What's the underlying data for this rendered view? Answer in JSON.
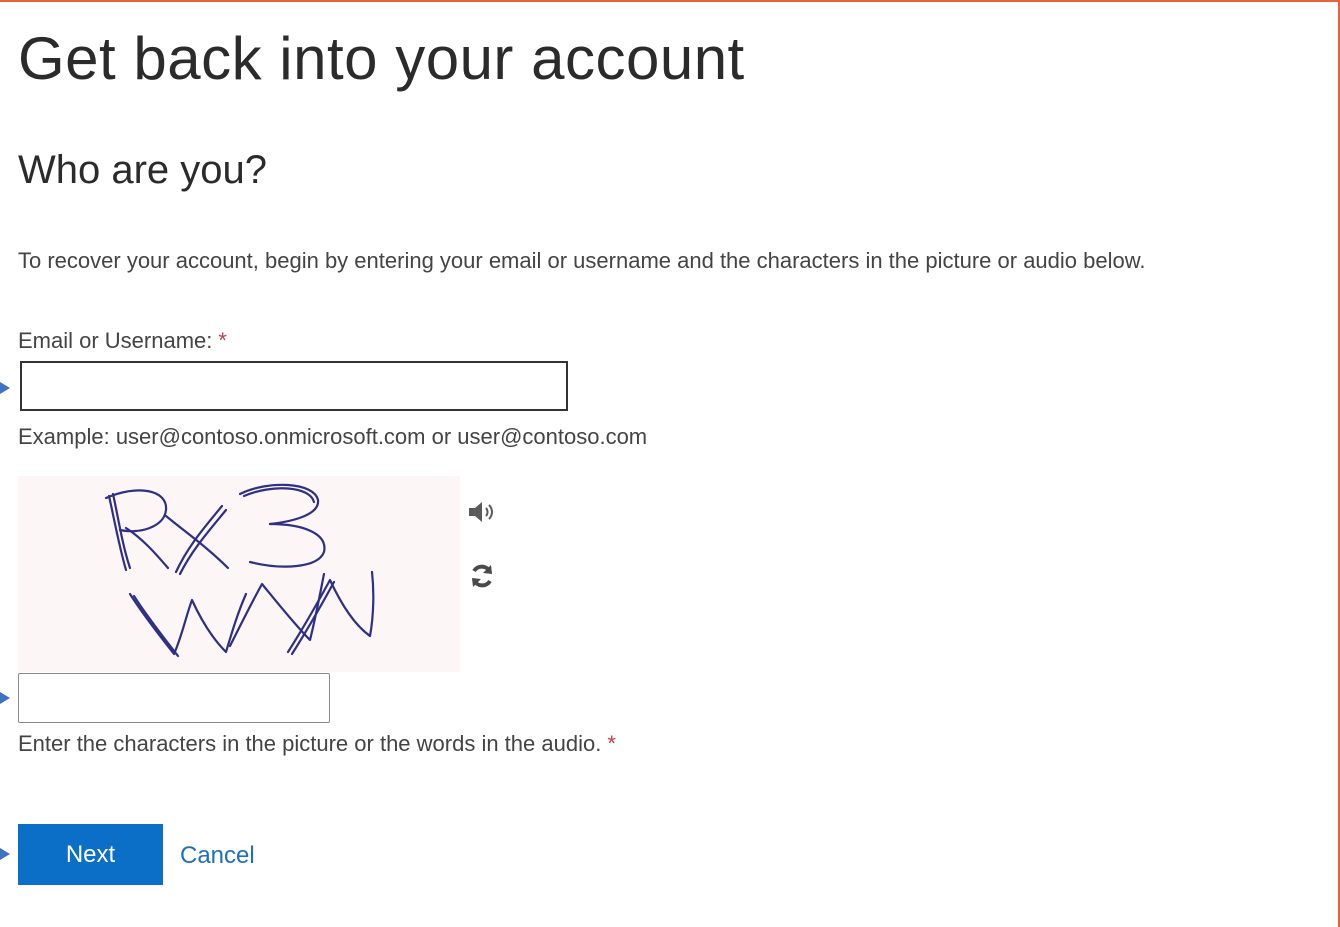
{
  "page": {
    "title": "Get back into your account",
    "subtitle": "Who are you?",
    "intro": "To recover your account, begin by entering your email or username and the characters in the picture or audio below."
  },
  "email": {
    "label": "Email or Username:",
    "required_mark": "*",
    "value": "",
    "placeholder": "",
    "example": "Example: user@contoso.onmicrosoft.com or user@contoso.com"
  },
  "captcha": {
    "image_text": "RX3WNN",
    "audio_icon": "speaker-icon",
    "refresh_icon": "refresh-icon",
    "value": "",
    "placeholder": "",
    "hint": "Enter the characters in the picture or the words in the audio.",
    "required_mark": "*"
  },
  "actions": {
    "next_label": "Next",
    "cancel_label": "Cancel"
  },
  "colors": {
    "accent": "#0b6fc7",
    "link": "#1e6fbf",
    "required": "#c2403b",
    "frame_border": "#e8623d",
    "annotation_arrow": "#3f72c2"
  }
}
